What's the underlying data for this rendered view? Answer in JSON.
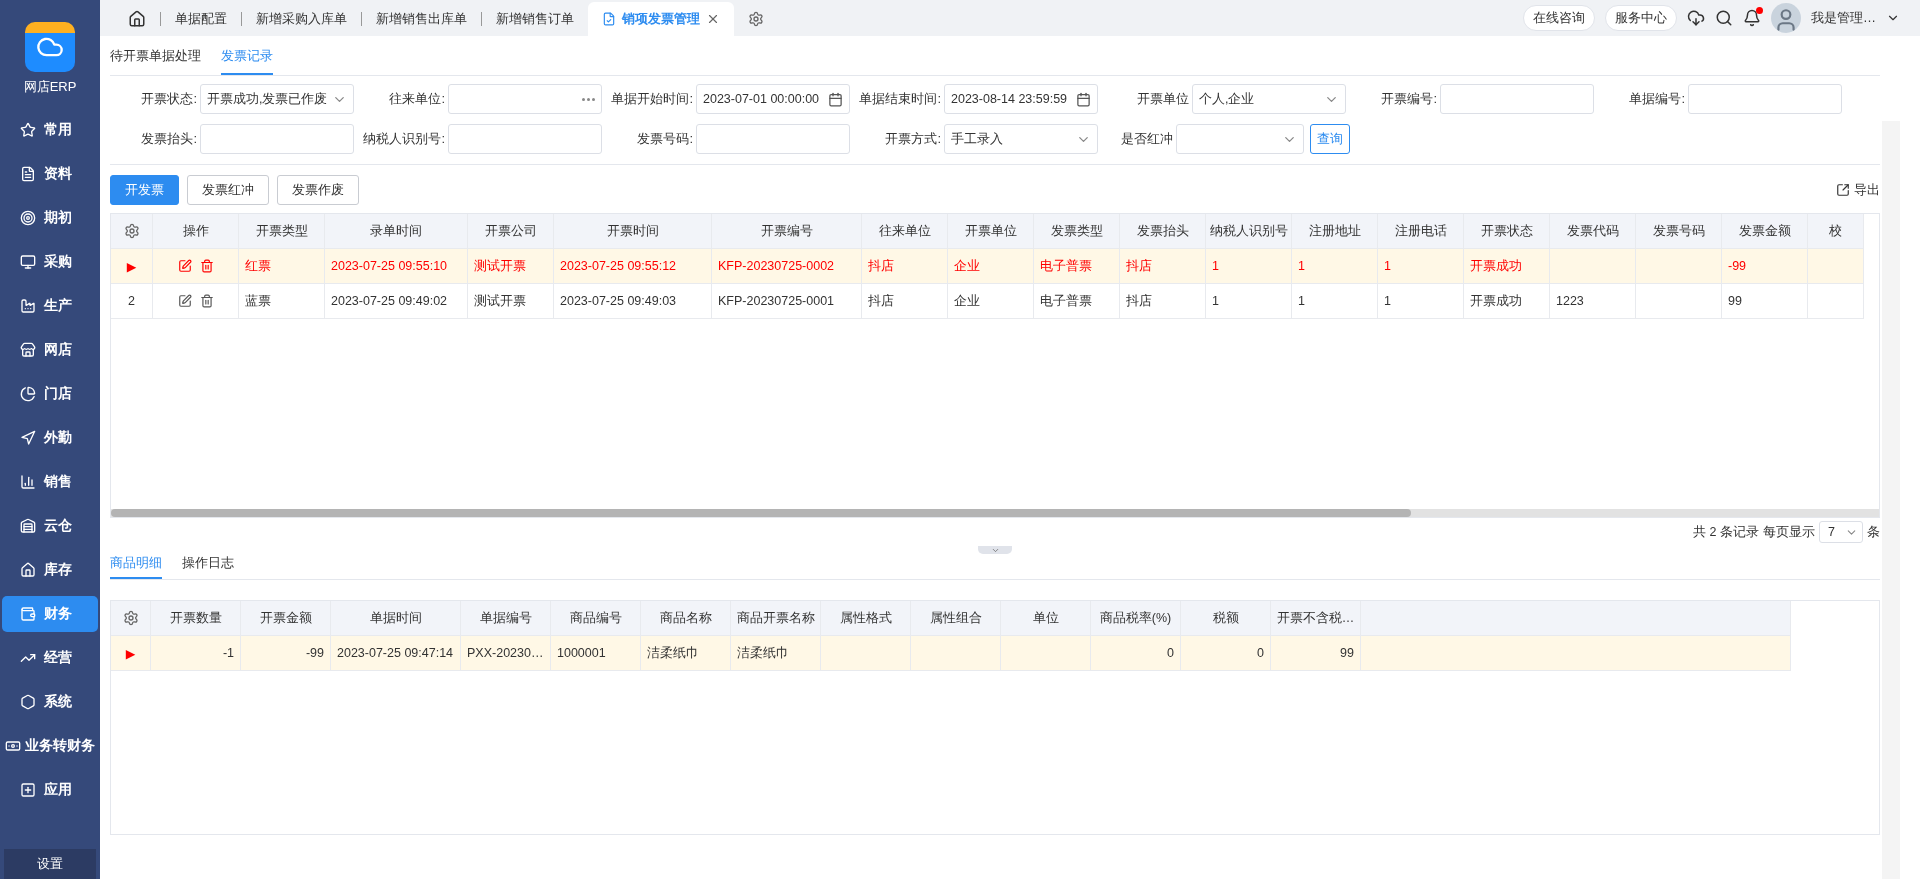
{
  "sidebar": {
    "brand": "网店ERP",
    "items": [
      {
        "label": "常用",
        "selected": false
      },
      {
        "label": "资料",
        "selected": false
      },
      {
        "label": "期初",
        "selected": false
      },
      {
        "label": "采购",
        "selected": false
      },
      {
        "label": "生产",
        "selected": false
      },
      {
        "label": "网店",
        "selected": false
      },
      {
        "label": "门店",
        "selected": false
      },
      {
        "label": "外勤",
        "selected": false
      },
      {
        "label": "销售",
        "selected": false
      },
      {
        "label": "云仓",
        "selected": false
      },
      {
        "label": "库存",
        "selected": false
      },
      {
        "label": "财务",
        "selected": true
      },
      {
        "label": "经营",
        "selected": false
      },
      {
        "label": "系统",
        "selected": false
      },
      {
        "label": "业务转财务",
        "selected": false
      },
      {
        "label": "应用",
        "selected": false
      }
    ],
    "settings": "设置"
  },
  "top_tabs": [
    {
      "label": "单据配置",
      "selected": false
    },
    {
      "label": "新增采购入库单",
      "selected": false
    },
    {
      "label": "新增销售出库单",
      "selected": false
    },
    {
      "label": "新增销售订单",
      "selected": false
    },
    {
      "label": "销项发票管理",
      "selected": true
    }
  ],
  "header_buttons": [
    "在线咨询",
    "服务中心"
  ],
  "user": {
    "name": "我是管理…"
  },
  "sub_tabs": [
    {
      "label": "待开票单据处理",
      "selected": false
    },
    {
      "label": "发票记录",
      "selected": true
    }
  ],
  "filters": [
    {
      "label": "开票状态:",
      "kind": "select",
      "value": "开票成功,发票已作废"
    },
    {
      "label": "往来单位:",
      "kind": "lookup"
    },
    {
      "label": "单据开始时间:",
      "kind": "date",
      "value": "2023-07-01 00:00:00"
    },
    {
      "label": "单据结束时间:",
      "kind": "date",
      "value": "2023-08-14 23:59:59"
    },
    {
      "label": "开票单位",
      "kind": "select",
      "value": "个人,企业"
    },
    {
      "label": "开票编号:",
      "kind": "input"
    },
    {
      "label": "单据编号:",
      "kind": "input"
    },
    {
      "label": "发票抬头:",
      "kind": "input"
    },
    {
      "label": "纳税人识别号:",
      "kind": "input"
    },
    {
      "label": "发票号码:",
      "kind": "input"
    },
    {
      "label": "开票方式:",
      "kind": "select",
      "value": "手工录入"
    },
    {
      "label": "是否红冲",
      "kind": "select"
    }
  ],
  "query_button": "查询",
  "actions": [
    {
      "label": "开发票",
      "kind": "primary"
    },
    {
      "label": "发票红冲",
      "kind": "default"
    },
    {
      "label": "发票作废",
      "kind": "default"
    }
  ],
  "export": "导出",
  "invoice_table": {
    "columns": [
      "操作",
      "开票类型",
      "录单时间",
      "开票公司",
      "开票时间",
      "开票编号",
      "往来单位",
      "开票单位",
      "发票类型",
      "发票抬头",
      "纳税人识别号",
      "注册地址",
      "注册电话",
      "开票状态",
      "发票代码",
      "发票号码",
      "发票金额",
      "校"
    ],
    "rows": [
      {
        "selected": true,
        "kind": "red",
        "marker": "▶",
        "cells": [
          "",
          "红票",
          "2023-07-25 09:55:10",
          "测试开票",
          "2023-07-25 09:55:12",
          "KFP-20230725-0002",
          "抖店",
          "企业",
          "电子普票",
          "抖店",
          "1",
          "1",
          "1",
          "开票成功",
          "",
          "",
          "-99",
          ""
        ]
      },
      {
        "selected": false,
        "kind": "blue",
        "index": "2",
        "cells": [
          "",
          "蓝票",
          "2023-07-25 09:49:02",
          "测试开票",
          "2023-07-25 09:49:03",
          "KFP-20230725-0001",
          "抖店",
          "企业",
          "电子普票",
          "抖店",
          "1",
          "1",
          "1",
          "开票成功",
          "1223",
          "",
          "99",
          ""
        ]
      }
    ]
  },
  "pagination": {
    "total": "共 2 条记录",
    "per_page_label": "每页显示",
    "per_page": "7",
    "unit": "条"
  },
  "detail_tabs": [
    {
      "label": "商品明细",
      "selected": true
    },
    {
      "label": "操作日志",
      "selected": false
    }
  ],
  "detail_table": {
    "columns": [
      "开票数量",
      "开票金额",
      "单据时间",
      "单据编号",
      "商品编号",
      "商品名称",
      "商品开票名称",
      "属性格式",
      "属性组合",
      "单位",
      "商品税率(%)",
      "税额",
      "开票不含税…"
    ],
    "rows": [
      {
        "selected": true,
        "marker": "▶",
        "cells": [
          "-1",
          "-99",
          "2023-07-25 09:47:14",
          "PXX-20230…",
          "1000001",
          "洁柔纸巾",
          "洁柔纸巾",
          "",
          "",
          "",
          "0",
          "0",
          "99"
        ]
      }
    ]
  }
}
